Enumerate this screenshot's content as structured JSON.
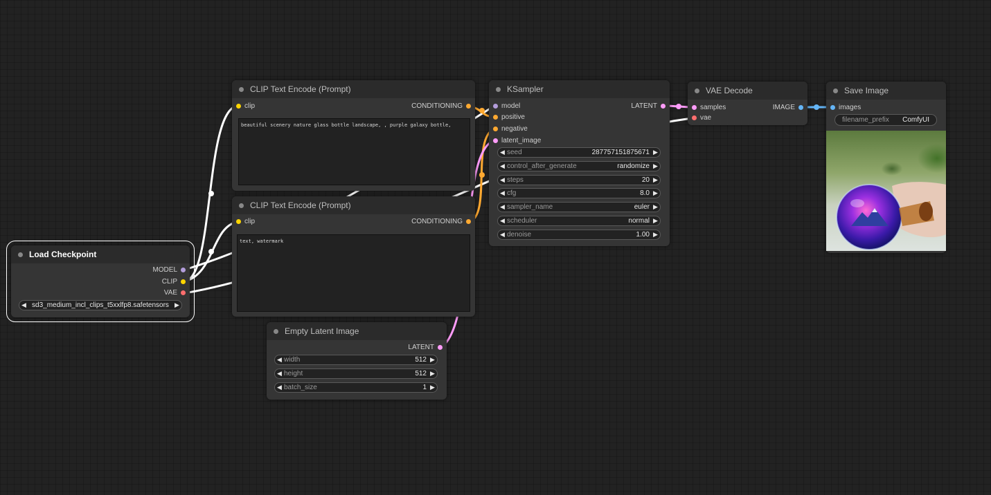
{
  "nodes": {
    "load_checkpoint": {
      "title": "Load Checkpoint",
      "outputs": [
        "MODEL",
        "CLIP",
        "VAE"
      ],
      "ckpt_name": "sd3_medium_incl_clips_t5xxlfp8.safetensors"
    },
    "clip_positive": {
      "title": "CLIP Text Encode (Prompt)",
      "input": "clip",
      "output": "CONDITIONING",
      "text": "beautiful scenery nature glass bottle landscape, , purple galaxy bottle,"
    },
    "clip_negative": {
      "title": "CLIP Text Encode (Prompt)",
      "input": "clip",
      "output": "CONDITIONING",
      "text": "text, watermark"
    },
    "ksampler": {
      "title": "KSampler",
      "inputs": [
        "model",
        "positive",
        "negative",
        "latent_image"
      ],
      "output": "LATENT",
      "widgets": [
        {
          "label": "seed",
          "value": "287757151875671"
        },
        {
          "label": "control_after_generate",
          "value": "randomize"
        },
        {
          "label": "steps",
          "value": "20"
        },
        {
          "label": "cfg",
          "value": "8.0"
        },
        {
          "label": "sampler_name",
          "value": "euler"
        },
        {
          "label": "scheduler",
          "value": "normal"
        },
        {
          "label": "denoise",
          "value": "1.00"
        }
      ]
    },
    "empty_latent": {
      "title": "Empty Latent Image",
      "output": "LATENT",
      "widgets": [
        {
          "label": "width",
          "value": "512"
        },
        {
          "label": "height",
          "value": "512"
        },
        {
          "label": "batch_size",
          "value": "1"
        }
      ]
    },
    "vae_decode": {
      "title": "VAE Decode",
      "inputs": [
        "samples",
        "vae"
      ],
      "output": "IMAGE"
    },
    "save_image": {
      "title": "Save Image",
      "input": "images",
      "filename_prefix_label": "filename_prefix",
      "filename_prefix": "ComfyUI"
    }
  },
  "colors": {
    "model": "#b39ddb",
    "clip": "#ffd500",
    "vae": "#ff6e6e",
    "conditioning": "#ffa931",
    "latent": "#ff9cf9",
    "image": "#64b5f6"
  }
}
